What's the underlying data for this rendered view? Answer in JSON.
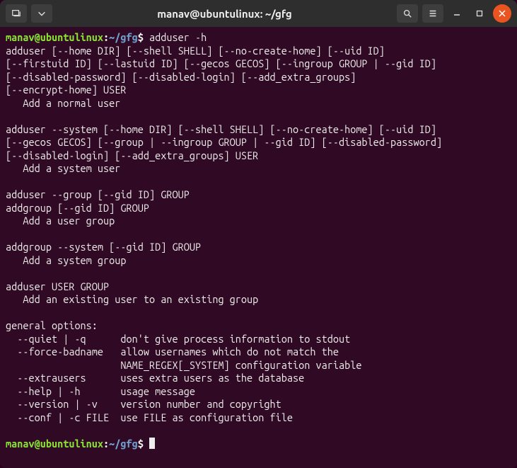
{
  "titlebar": {
    "title": "manav@ubuntulinux: ~/gfg"
  },
  "prompt": {
    "userhost": "manav@ubuntulinux",
    "colon": ":",
    "path": "~/gfg",
    "dollar": "$"
  },
  "command1": "adduser -h",
  "output": {
    "l1": "adduser [--home DIR] [--shell SHELL] [--no-create-home] [--uid ID]",
    "l2": "[--firstuid ID] [--lastuid ID] [--gecos GECOS] [--ingroup GROUP | --gid ID]",
    "l3": "[--disabled-password] [--disabled-login] [--add_extra_groups]",
    "l4": "[--encrypt-home] USER",
    "l5": "   Add a normal user",
    "blank1": "",
    "l6": "adduser --system [--home DIR] [--shell SHELL] [--no-create-home] [--uid ID]",
    "l7": "[--gecos GECOS] [--group | --ingroup GROUP | --gid ID] [--disabled-password]",
    "l8": "[--disabled-login] [--add_extra_groups] USER",
    "l9": "   Add a system user",
    "blank2": "",
    "l10": "adduser --group [--gid ID] GROUP",
    "l11": "addgroup [--gid ID] GROUP",
    "l12": "   Add a user group",
    "blank3": "",
    "l13": "addgroup --system [--gid ID] GROUP",
    "l14": "   Add a system group",
    "blank4": "",
    "l15": "adduser USER GROUP",
    "l16": "   Add an existing user to an existing group",
    "blank5": "",
    "l17": "general options:",
    "l18": "  --quiet | -q      don't give process information to stdout",
    "l19": "  --force-badname   allow usernames which do not match the",
    "l20": "                    NAME_REGEX[_SYSTEM] configuration variable",
    "l21": "  --extrausers      uses extra users as the database",
    "l22": "  --help | -h       usage message",
    "l23": "  --version | -v    version number and copyright",
    "l24": "  --conf | -c FILE  use FILE as configuration file"
  }
}
